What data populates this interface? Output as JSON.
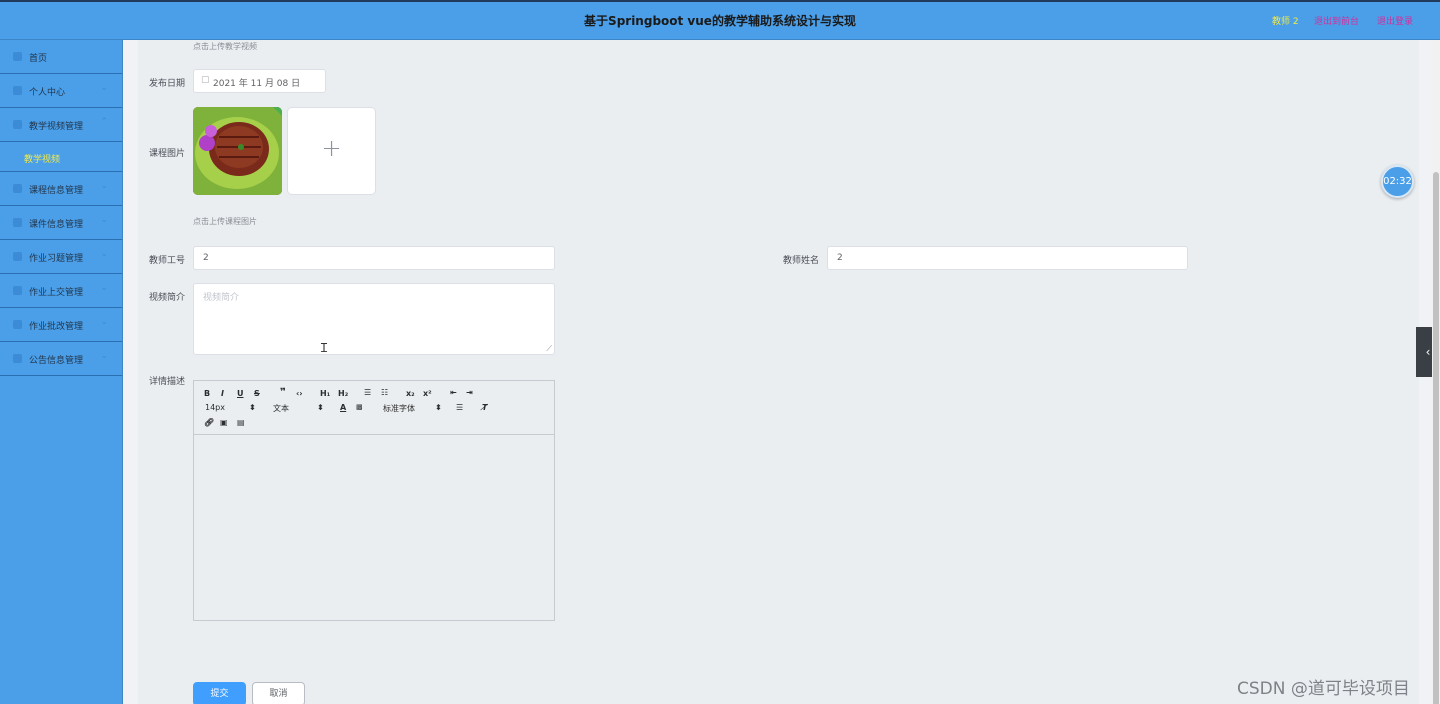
{
  "header": {
    "title": "基于Springboot vue的教学辅助系统设计与实现",
    "user": "教师 2",
    "back_label": "退出到前台",
    "logout_label": "退出登录"
  },
  "sidebar": {
    "items": [
      {
        "label": "首页"
      },
      {
        "label": "个人中心"
      },
      {
        "label": "教学视频管理"
      },
      {
        "label": "课程信息管理"
      },
      {
        "label": "课件信息管理"
      },
      {
        "label": "作业习题管理"
      },
      {
        "label": "作业上交管理"
      },
      {
        "label": "作业批改管理"
      },
      {
        "label": "公告信息管理"
      }
    ],
    "submenu_active": "教学视频"
  },
  "form": {
    "video_hint": "点击上传教学视频",
    "date_label": "发布日期",
    "date_value": "2021 年 11 月 08 日",
    "image_label": "课程图片",
    "image_hint": "点击上传课程图片",
    "teacher_id_label": "教师工号",
    "teacher_id_value": "2",
    "teacher_name_label": "教师姓名",
    "teacher_name_value": "2",
    "intro_label": "视频简介",
    "intro_placeholder": "视频简介",
    "detail_label": "详情描述",
    "submit_label": "提交",
    "cancel_label": "取消"
  },
  "editor": {
    "size": "14px",
    "text": "文本",
    "font": "标准字体"
  },
  "timer": "02:32",
  "watermark": "CSDN @道可毕设项目"
}
